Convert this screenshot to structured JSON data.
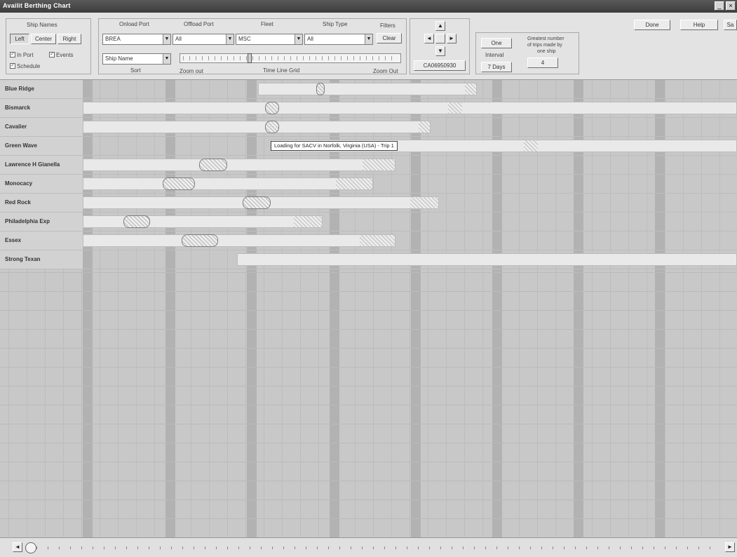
{
  "window": {
    "title": "Availit Berthing Chart",
    "min_glyph": "_",
    "close_glyph": "×"
  },
  "toolbar": {
    "ship_names_label": "Ship Names",
    "align_left": "Left",
    "align_center": "Center",
    "align_right": "Right",
    "check_in_port": "In Port",
    "check_events": "Events",
    "check_schedule": "Schedule",
    "onload_port_label": "Onload Port",
    "onload_port_value": "BREA",
    "offload_port_label": "Offload Port",
    "offload_port_value": "All",
    "fleet_label": "Fleet",
    "fleet_value": "MSC",
    "ship_type_label": "Ship Type",
    "ship_type_value": "All",
    "filters_label": "Filters",
    "filters_clear": "Clear",
    "sort_value": "Ship Name",
    "sort_label": "Sort",
    "zoom_out_label": "Zoom out",
    "time_line_grid_label": "Time Line Grid",
    "zoom_in_label": "Zoom Out",
    "date_code": "CA06950930",
    "interval_value": "One",
    "interval_label": "Interval",
    "interval_unit": "7 Days",
    "greatest_label_1": "Greatest number",
    "greatest_label_2": "of trips made by",
    "greatest_label_3": "one ship",
    "greatest_value": "4",
    "done_button": "Done",
    "help_button": "Help",
    "extra_button": "Sa"
  },
  "ships": [
    {
      "name": "Blue Ridge"
    },
    {
      "name": "Bismarck"
    },
    {
      "name": "Cavalier"
    },
    {
      "name": "Green Wave"
    },
    {
      "name": "Lawrence H Gianella"
    },
    {
      "name": "Monocacy"
    },
    {
      "name": "Red Rock"
    },
    {
      "name": "Philadelphia Exp"
    },
    {
      "name": "Essex"
    },
    {
      "name": "Strong Texan"
    }
  ],
  "tooltip": "Loading for SACV in Norfolk, Virginia (USA) - Trip 1",
  "scrollbar": {
    "left_glyph": "◄",
    "right_glyph": "►"
  }
}
